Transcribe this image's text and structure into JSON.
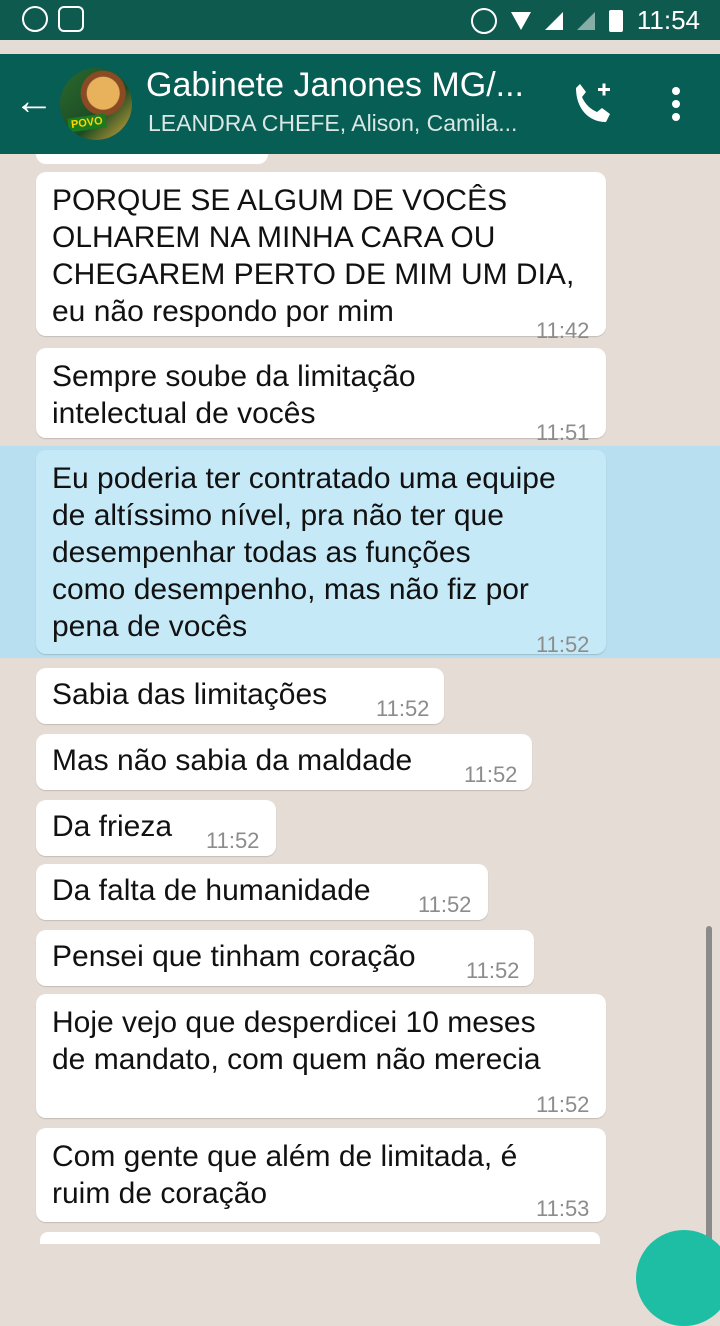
{
  "status_bar": {
    "time": "11:54"
  },
  "header": {
    "title": "Gabinete Janones MG/...",
    "subtitle": "LEANDRA CHEFE, Alison, Camila...",
    "avatar_text": "POVO"
  },
  "messages": [
    {
      "lines": [
        "PORQUE SE ALGUM DE VOCÊS",
        "OLHAREM NA MINHA CARA OU",
        "CHEGAREM PERTO DE MIM UM DIA,",
        "eu não respondo por mim"
      ],
      "time": "11:42"
    },
    {
      "lines": [
        "Sempre soube da limitação",
        "intelectual de vocês"
      ],
      "time": "11:51"
    },
    {
      "lines": [
        "Eu poderia ter contratado uma equipe",
        "de altíssimo nível, pra não ter que",
        "desempenhar todas as funções",
        "como desempenho, mas não fiz por",
        "pena de vocês"
      ],
      "time": "11:52"
    },
    {
      "lines": [
        "Sabia das limitações"
      ],
      "time": "11:52"
    },
    {
      "lines": [
        "Mas não sabia da maldade"
      ],
      "time": "11:52"
    },
    {
      "lines": [
        "Da frieza"
      ],
      "time": "11:52"
    },
    {
      "lines": [
        "Da falta de humanidade"
      ],
      "time": "11:52"
    },
    {
      "lines": [
        "Pensei que tinham coração"
      ],
      "time": "11:52"
    },
    {
      "lines": [
        "Hoje vejo que desperdicei 10 meses",
        "de mandato, com quem não merecia"
      ],
      "time": "11:52"
    },
    {
      "lines": [
        "Com gente que além de limitada, é",
        "ruim de coração"
      ],
      "time": "11:53"
    }
  ]
}
